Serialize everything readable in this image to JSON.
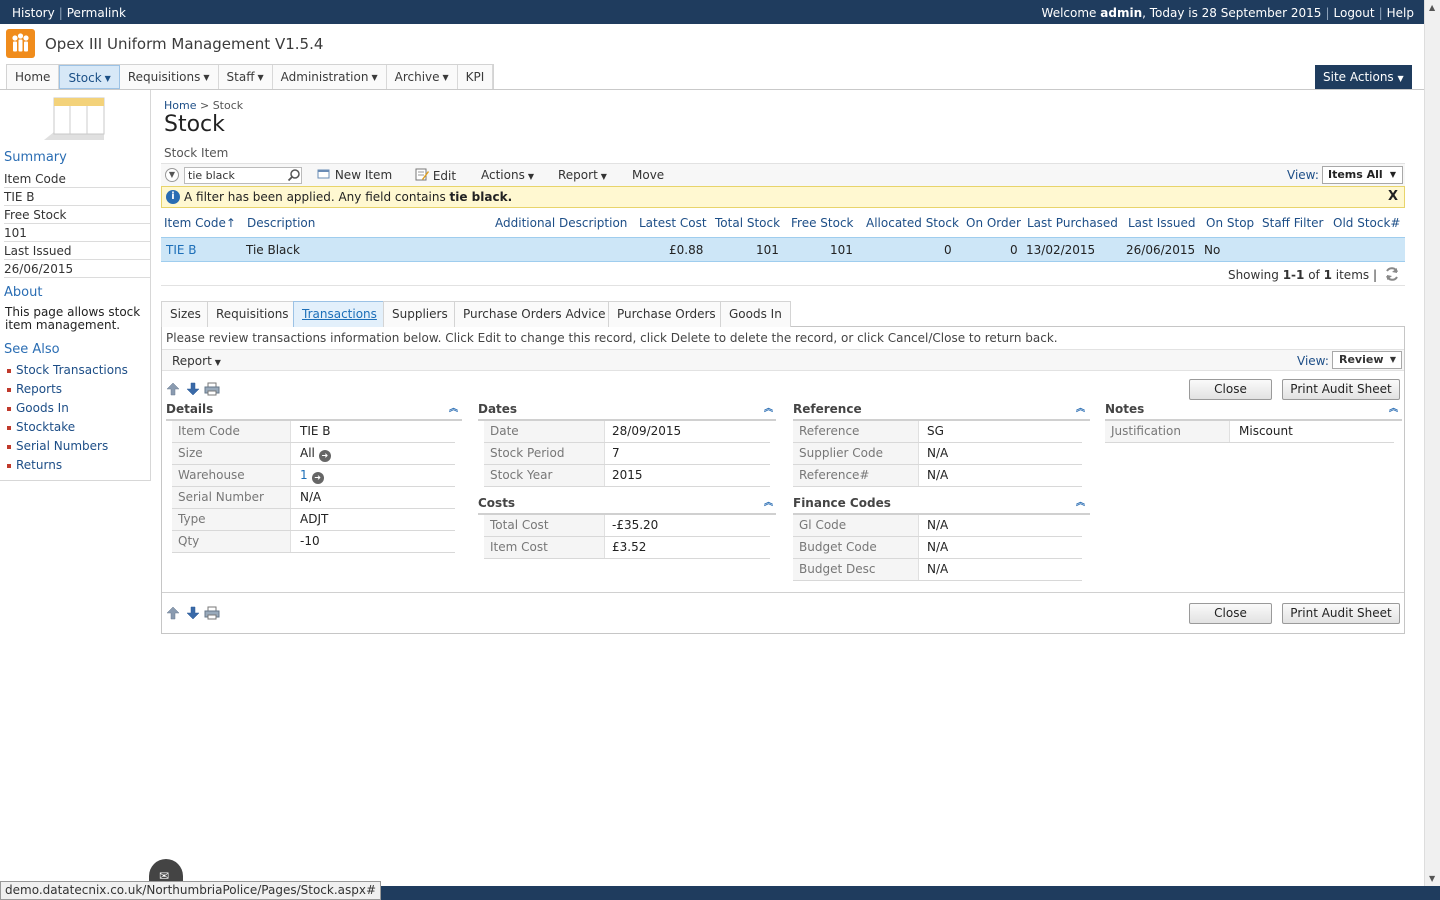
{
  "topbar": {
    "history": "History",
    "permalink": "Permalink",
    "welcome": "Welcome",
    "user": "admin",
    "today": ", Today is 28 September 2015",
    "logout": "Logout",
    "help": "Help"
  },
  "app": {
    "title": "Opex III Uniform Management V1.5.4",
    "brand_color": "#f08c1c"
  },
  "nav": {
    "items": [
      "Home",
      "Stock",
      "Requisitions",
      "Staff",
      "Administration",
      "Archive",
      "KPI"
    ],
    "site_actions": "Site Actions"
  },
  "leftpanel": {
    "summary_heading": "Summary",
    "rows": [
      "Item Code",
      "TIE B",
      "Free Stock",
      "101",
      "Last Issued",
      "26/06/2015"
    ],
    "about_heading": "About",
    "about_text": "This page allows stock item management.",
    "see_also_heading": "See Also",
    "links": [
      "Stock Transactions",
      "Reports",
      "Goods In",
      "Stocktake",
      "Serial Numbers",
      "Returns"
    ]
  },
  "breadcrumb": {
    "home": "Home",
    "sep": ">",
    "current": "Stock"
  },
  "page": {
    "title": "Stock",
    "section": "Stock Item"
  },
  "toolbar": {
    "search_value": "tie black",
    "new_item": "New Item",
    "edit": "Edit",
    "actions": "Actions",
    "report": "Report",
    "move": "Move",
    "view_label": "View:",
    "view_value": "Items All"
  },
  "filter": {
    "message": "A filter has been applied. Any field contains ",
    "term": "tie black."
  },
  "grid": {
    "headers": [
      "Item Code↑",
      "Description",
      "Additional Description",
      "Latest Cost",
      "Total Stock",
      "Free Stock",
      "Allocated Stock",
      "On Order",
      "Last Purchased",
      "Last Issued",
      "On Stop",
      "Staff Filter",
      "Old Stock#"
    ],
    "row": {
      "item_code": "TIE B",
      "description": "Tie Black",
      "additional_description": "",
      "latest_cost": "£0.88",
      "total_stock": "101",
      "free_stock": "101",
      "allocated_stock": "0",
      "on_order": "0",
      "last_purchased": "13/02/2015",
      "last_issued": "26/06/2015",
      "on_stop": "No"
    },
    "showing_prefix": "Showing ",
    "showing_range": "1-1",
    "showing_of": " of ",
    "showing_total": "1",
    "showing_suffix": " items"
  },
  "tabs": [
    "Sizes",
    "Requisitions",
    "Transactions",
    "Suppliers",
    "Purchase Orders Advice",
    "Purchase Orders",
    "Goods In"
  ],
  "detail": {
    "instructions": "Please review transactions information below. Click Edit to change this record, click Delete to delete the record, or click Cancel/Close to return back.",
    "report": "Report",
    "view_label": "View:",
    "view_value": "Review",
    "close": "Close",
    "print": "Print Audit Sheet",
    "details": {
      "title": "Details",
      "fields": [
        {
          "k": "Item Code",
          "v": "TIE B"
        },
        {
          "k": "Size",
          "v": "All"
        },
        {
          "k": "Warehouse",
          "v": "1"
        },
        {
          "k": "Serial Number",
          "v": "N/A"
        },
        {
          "k": "Type",
          "v": "ADJT"
        },
        {
          "k": "Qty",
          "v": "-10"
        }
      ]
    },
    "dates": {
      "title": "Dates",
      "fields": [
        {
          "k": "Date",
          "v": "28/09/2015"
        },
        {
          "k": "Stock Period",
          "v": "7"
        },
        {
          "k": "Stock Year",
          "v": "2015"
        }
      ]
    },
    "costs": {
      "title": "Costs",
      "fields": [
        {
          "k": "Total Cost",
          "v": "-£35.20"
        },
        {
          "k": "Item Cost",
          "v": "£3.52"
        }
      ]
    },
    "reference": {
      "title": "Reference",
      "fields": [
        {
          "k": "Reference",
          "v": "SG"
        },
        {
          "k": "Supplier Code",
          "v": "N/A"
        },
        {
          "k": "Reference#",
          "v": "N/A"
        }
      ]
    },
    "finance": {
      "title": "Finance Codes",
      "fields": [
        {
          "k": "Gl Code",
          "v": "N/A"
        },
        {
          "k": "Budget Code",
          "v": "N/A"
        },
        {
          "k": "Budget Desc",
          "v": "N/A"
        }
      ]
    },
    "notes": {
      "title": "Notes",
      "fields": [
        {
          "k": "Justification",
          "v": "Miscount"
        }
      ]
    }
  },
  "status": {
    "url": "demo.datatecnix.co.uk/NorthumbriaPolice/Pages/Stock.aspx#"
  }
}
